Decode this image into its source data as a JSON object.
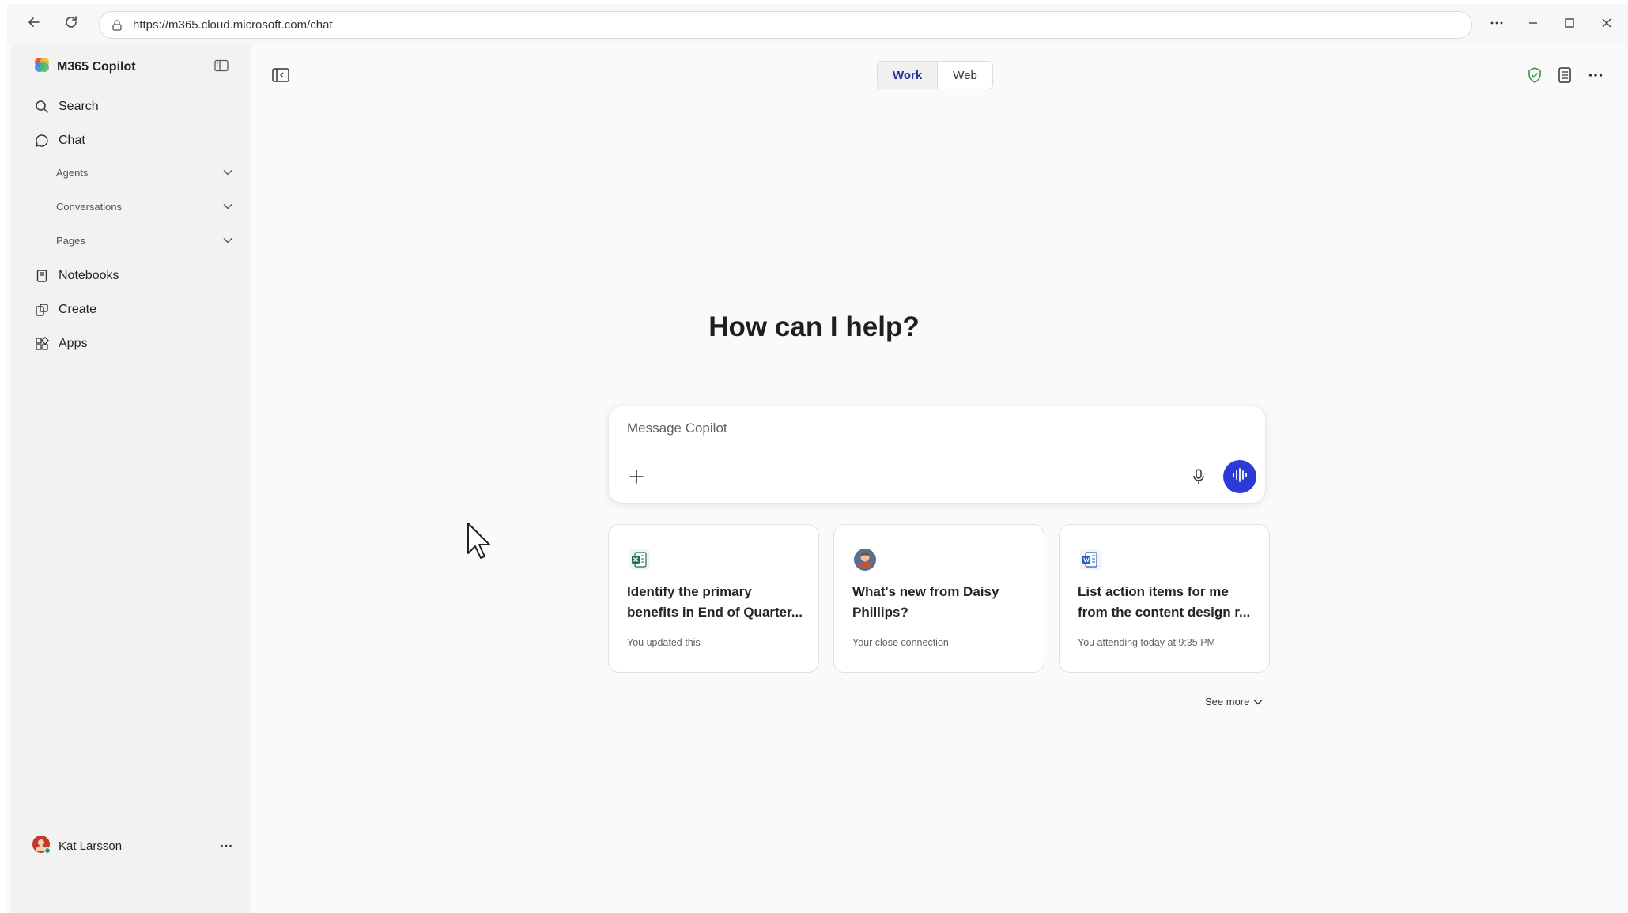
{
  "browser": {
    "url": "https://m365.cloud.microsoft.com/chat",
    "icons": [
      "back-arrow-icon",
      "refresh-icon",
      "lock-icon",
      "more-icon",
      "minimize-icon",
      "maximize-icon",
      "close-icon"
    ]
  },
  "sidebar": {
    "brand": "M365 Copilot",
    "items": [
      {
        "label": "Search",
        "icon": "search-icon"
      },
      {
        "label": "Chat",
        "icon": "chat-icon"
      }
    ],
    "sub_items": [
      {
        "label": "Agents"
      },
      {
        "label": "Conversations"
      },
      {
        "label": "Pages"
      }
    ],
    "items_bottom": [
      {
        "label": "Notebooks",
        "icon": "notebook-icon"
      },
      {
        "label": "Create",
        "icon": "create-icon"
      },
      {
        "label": "Apps",
        "icon": "apps-icon"
      }
    ],
    "user": {
      "name": "Kat Larsson"
    }
  },
  "header": {
    "toggle": [
      {
        "label": "Work",
        "selected": true
      },
      {
        "label": "Web",
        "selected": false
      }
    ]
  },
  "main": {
    "headline": "How can I help?",
    "composer": {
      "placeholder": "Message Copilot"
    },
    "cards": [
      {
        "icon": "excel-file-icon",
        "title": "Identify the primary benefits in End of Quarter...",
        "subtitle": "You updated this"
      },
      {
        "icon": "person-avatar-icon",
        "title": "What's new from Daisy Phillips?",
        "subtitle": "Your close connection"
      },
      {
        "icon": "word-file-icon",
        "title": "List action items for me from the content design r...",
        "subtitle": "You attending today at 9:35 PM"
      }
    ],
    "see_more": "See more"
  },
  "colors": {
    "accent": "#2a3bd6",
    "toggle_active_text": "#2b2f9c",
    "sidebar_bg": "#f2f2f2",
    "main_bg": "#fafafa"
  }
}
